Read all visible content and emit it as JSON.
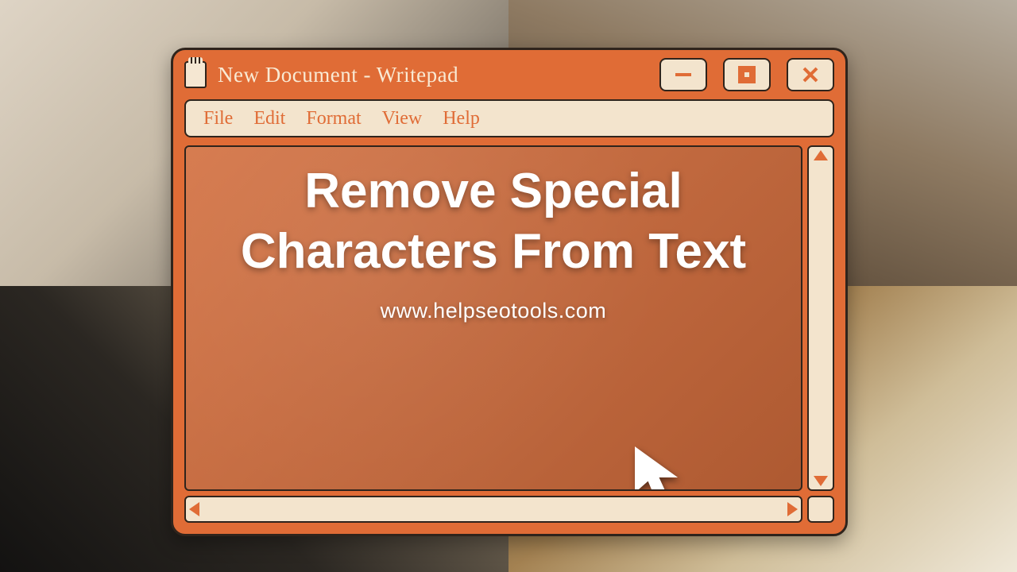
{
  "window": {
    "title": "New Document - Writepad",
    "controls": {
      "minimize": "minimize",
      "maximize": "maximize",
      "close": "close"
    }
  },
  "menu": {
    "items": [
      "File",
      "Edit",
      "Format",
      "View",
      "Help"
    ]
  },
  "content": {
    "headline": "Remove Special Characters From Text",
    "url": "www.helpseotools.com"
  },
  "scrollbars": {
    "vertical": {
      "up": "scroll-up",
      "down": "scroll-down"
    },
    "horizontal": {
      "left": "scroll-left",
      "right": "scroll-right"
    }
  },
  "colors": {
    "accent": "#e06c36",
    "panel": "#f3e4cd",
    "outline": "#2f241c",
    "text_on_accent": "#f9ead4"
  }
}
